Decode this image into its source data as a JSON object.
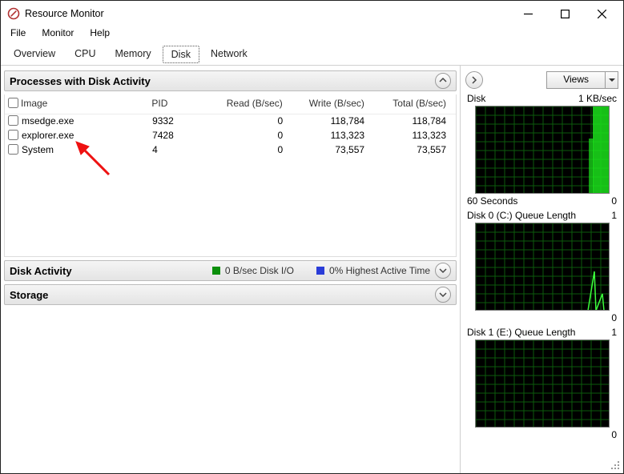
{
  "window": {
    "title": "Resource Monitor"
  },
  "menubar": {
    "items": [
      "File",
      "Monitor",
      "Help"
    ]
  },
  "tabs": [
    "Overview",
    "CPU",
    "Memory",
    "Disk",
    "Network"
  ],
  "tab_selected_index": 3,
  "left": {
    "processes": {
      "title": "Processes with Disk Activity",
      "columns": [
        "Image",
        "PID",
        "Read (B/sec)",
        "Write (B/sec)",
        "Total (B/sec)"
      ],
      "rows": [
        {
          "image": "msedge.exe",
          "pid": "9332",
          "read": "0",
          "write": "118,784",
          "total": "118,784"
        },
        {
          "image": "explorer.exe",
          "pid": "7428",
          "read": "0",
          "write": "113,323",
          "total": "113,323"
        },
        {
          "image": "System",
          "pid": "4",
          "read": "0",
          "write": "73,557",
          "total": "73,557"
        }
      ]
    },
    "disk_activity": {
      "title": "Disk Activity",
      "io_label": "0 B/sec Disk I/O",
      "active_label": "0% Highest Active Time",
      "io_color": "#0b8f0b",
      "active_color": "#2a3cd8"
    },
    "storage": {
      "title": "Storage"
    }
  },
  "right": {
    "views_label": "Views",
    "charts": [
      {
        "head_left": "Disk",
        "head_right": "1 KB/sec",
        "foot_left": "60 Seconds",
        "foot_right": "0",
        "fill": true
      },
      {
        "head_left": "Disk 0 (C:) Queue Length",
        "head_right": "1",
        "foot_left": "",
        "foot_right": "0",
        "fill": false,
        "spike": true
      },
      {
        "head_left": "Disk 1 (E:) Queue Length",
        "head_right": "1",
        "foot_left": "",
        "foot_right": "0",
        "fill": false
      }
    ]
  },
  "chart_data": [
    {
      "type": "area",
      "title": "Disk",
      "ylabel": "KB/sec",
      "ylim": [
        0,
        1
      ],
      "x": [
        0,
        1,
        2,
        3,
        4,
        5,
        6,
        7,
        8,
        9,
        10,
        11,
        12,
        13,
        14,
        15,
        16,
        17,
        18,
        19,
        20,
        21,
        22,
        23,
        24,
        25,
        26,
        27,
        28,
        29,
        30,
        31,
        32,
        33,
        34,
        35,
        36,
        37,
        38,
        39,
        40,
        41,
        42,
        43,
        44,
        45,
        46,
        47,
        48,
        49,
        50,
        51,
        52,
        53,
        54,
        55,
        56,
        57,
        58,
        59
      ],
      "values": [
        0,
        0,
        0,
        0,
        0,
        0,
        0,
        0,
        0,
        0,
        0,
        0,
        0,
        0,
        0,
        0,
        0,
        0,
        0,
        0,
        0,
        0,
        0,
        0,
        0,
        0,
        0,
        0,
        0,
        0,
        0,
        0,
        0,
        0,
        0,
        0,
        0,
        0,
        0,
        0,
        0,
        0,
        0,
        0,
        0,
        0,
        0,
        0,
        0,
        0,
        0,
        0,
        0.6,
        1,
        1,
        1,
        1,
        1,
        1,
        1
      ],
      "xlabel": "60 Seconds"
    },
    {
      "type": "line",
      "title": "Disk 0 (C:) Queue Length",
      "ylabel": "",
      "ylim": [
        0,
        1
      ],
      "x": [
        0,
        1,
        2,
        3,
        4,
        5,
        6,
        7,
        8,
        9,
        10,
        11,
        12,
        13,
        14,
        15,
        16,
        17,
        18,
        19,
        20,
        21,
        22,
        23,
        24,
        25,
        26,
        27,
        28,
        29,
        30,
        31,
        32,
        33,
        34,
        35,
        36,
        37,
        38,
        39,
        40,
        41,
        42,
        43,
        44,
        45,
        46,
        47,
        48,
        49,
        50,
        51,
        52,
        53,
        54,
        55,
        56,
        57,
        58,
        59
      ],
      "values": [
        0,
        0,
        0,
        0,
        0,
        0,
        0,
        0,
        0,
        0,
        0,
        0,
        0,
        0,
        0,
        0,
        0,
        0,
        0,
        0,
        0,
        0,
        0,
        0,
        0,
        0,
        0,
        0,
        0,
        0,
        0,
        0,
        0,
        0,
        0,
        0,
        0,
        0,
        0,
        0,
        0,
        0,
        0,
        0,
        0,
        0,
        0,
        0,
        0,
        0,
        0,
        0,
        0,
        0.5,
        0,
        0,
        0.2,
        0,
        0,
        0
      ]
    },
    {
      "type": "line",
      "title": "Disk 1 (E:) Queue Length",
      "ylabel": "",
      "ylim": [
        0,
        1
      ],
      "x": [
        0,
        1,
        2,
        3,
        4,
        5,
        6,
        7,
        8,
        9,
        10,
        11,
        12,
        13,
        14,
        15,
        16,
        17,
        18,
        19,
        20,
        21,
        22,
        23,
        24,
        25,
        26,
        27,
        28,
        29,
        30,
        31,
        32,
        33,
        34,
        35,
        36,
        37,
        38,
        39,
        40,
        41,
        42,
        43,
        44,
        45,
        46,
        47,
        48,
        49,
        50,
        51,
        52,
        53,
        54,
        55,
        56,
        57,
        58,
        59
      ],
      "values": [
        0,
        0,
        0,
        0,
        0,
        0,
        0,
        0,
        0,
        0,
        0,
        0,
        0,
        0,
        0,
        0,
        0,
        0,
        0,
        0,
        0,
        0,
        0,
        0,
        0,
        0,
        0,
        0,
        0,
        0,
        0,
        0,
        0,
        0,
        0,
        0,
        0,
        0,
        0,
        0,
        0,
        0,
        0,
        0,
        0,
        0,
        0,
        0,
        0,
        0,
        0,
        0,
        0,
        0,
        0,
        0,
        0,
        0,
        0,
        0
      ]
    }
  ]
}
